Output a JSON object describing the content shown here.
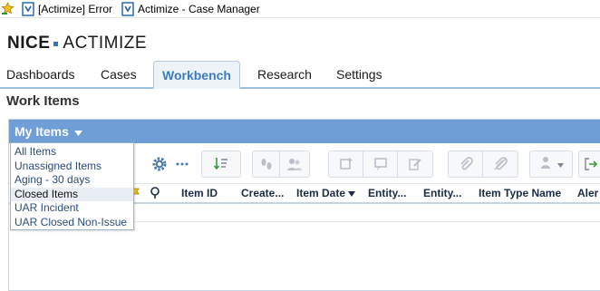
{
  "favorites": [
    {
      "label": "[Actimize] Error",
      "icon": "ie-page-icon"
    },
    {
      "label": "Actimize - Case Manager",
      "icon": "ie-page-icon"
    }
  ],
  "logo": {
    "brand": "NICE",
    "product": "ACTIMIZE"
  },
  "tabs": [
    {
      "label": "Dashboards",
      "active": false
    },
    {
      "label": "Cases",
      "active": false
    },
    {
      "label": "Workbench",
      "active": true
    },
    {
      "label": "Research",
      "active": false
    },
    {
      "label": "Settings",
      "active": false
    }
  ],
  "page_title": "Work Items",
  "panel": {
    "title": "My Items"
  },
  "filter_menu": {
    "items": [
      "All Items",
      "Unassigned Items",
      "Aging - 30 days",
      "Closed Items",
      "UAR Incident",
      "UAR Closed Non-Issue"
    ],
    "selected": "Closed Items"
  },
  "columns": [
    "Item ID",
    "Create...",
    "Item Date",
    "Entity...",
    "Entity...",
    "Item Type Name",
    "Aler"
  ],
  "sort": {
    "column": "Item Date",
    "direction": "descending"
  },
  "colors": {
    "accent": "#3a7cc2",
    "panel_header": "#6f9dd5",
    "brand_blue": "#2d74c4"
  }
}
